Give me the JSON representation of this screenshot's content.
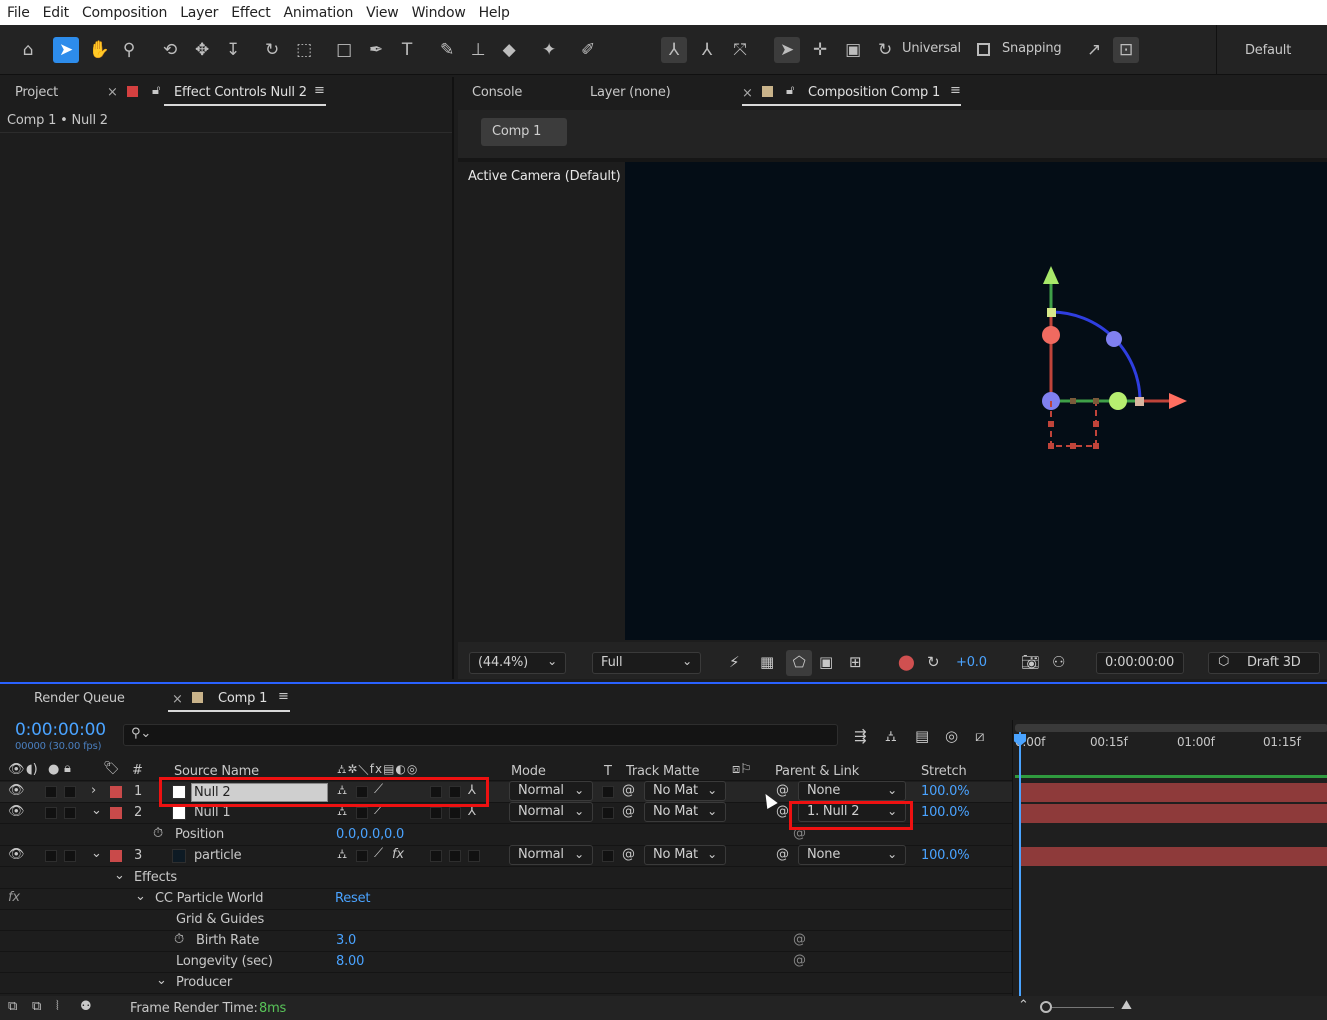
{
  "menu": [
    "File",
    "Edit",
    "Composition",
    "Layer",
    "Effect",
    "Animation",
    "View",
    "Window",
    "Help"
  ],
  "toolbar": {
    "universal_label": "Universal",
    "snapping_label": "Snapping",
    "workspace": "Default"
  },
  "left_panel": {
    "tab_project": "Project",
    "tab_effect_controls": "Effect Controls Null 2",
    "breadcrumb": "Comp 1 • Null 2"
  },
  "viewer": {
    "tab_console": "Console",
    "tab_layer": "Layer (none)",
    "tab_composition": "Composition Comp 1",
    "comp_button": "Comp 1",
    "camera_label": "Active Camera (Default)",
    "zoom": "(44.4%)",
    "resolution": "Full",
    "exposure": "+0.0",
    "timecode": "0:00:00:00",
    "renderer": "Draft 3D"
  },
  "timeline": {
    "tab_render_queue": "Render Queue",
    "tab_comp": "Comp 1",
    "current_time": "0:00:00:00",
    "frame_info": "00000 (30.00 fps)",
    "search_placeholder": "",
    "headers": {
      "num": "#",
      "source": "Source Name",
      "mode": "Mode",
      "t": "T",
      "track_matte": "Track Matte",
      "parent": "Parent & Link",
      "stretch": "Stretch"
    },
    "ruler": [
      "0:00f",
      "00:15f",
      "01:00f",
      "01:15f"
    ],
    "layers": [
      {
        "num": "1",
        "name": "Null 2",
        "mode": "Normal",
        "matte": "No Mat",
        "parent": "None",
        "stretch": "100.0%"
      },
      {
        "num": "2",
        "name": "Null 1",
        "mode": "Normal",
        "matte": "No Mat",
        "parent": "1. Null 2",
        "stretch": "100.0%"
      },
      {
        "num": "3",
        "name": "particle",
        "mode": "Normal",
        "matte": "No Mat",
        "parent": "None",
        "stretch": "100.0%"
      }
    ],
    "position_label": "Position",
    "position_value": "0.0,0.0,0.0",
    "effects_label": "Effects",
    "effect_name": "CC Particle World",
    "reset_label": "Reset",
    "grid_label": "Grid & Guides",
    "birth_label": "Birth Rate",
    "birth_value": "3.0",
    "longevity_label": "Longevity (sec)",
    "longevity_value": "8.00",
    "producer_label": "Producer",
    "render_time_label": "Frame Render Time:",
    "render_time_value": "8ms",
    "fx_label": "fx"
  }
}
